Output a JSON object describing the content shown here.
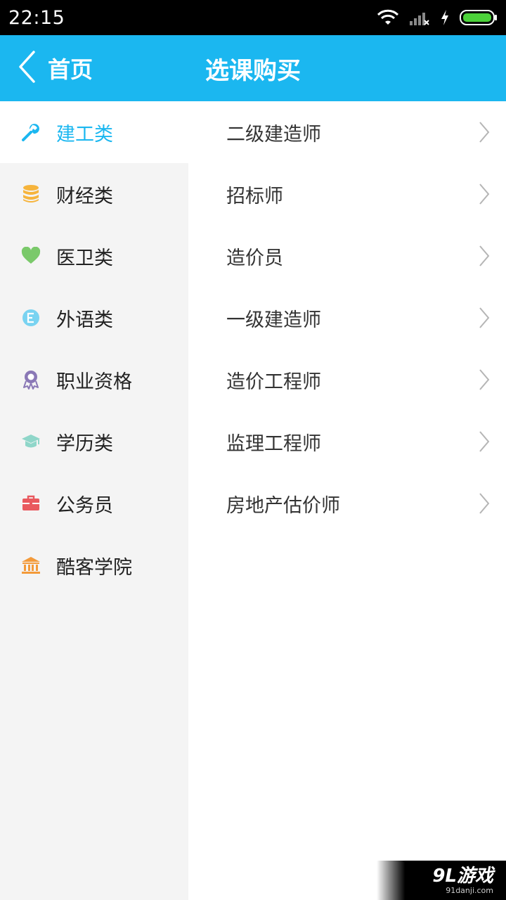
{
  "status_bar": {
    "time": "22:15"
  },
  "app_bar": {
    "back_label": "首页",
    "title": "选课购买"
  },
  "sidebar": {
    "items": [
      {
        "label": "建工类",
        "icon": "wrench-icon",
        "color": "#1bb7f0",
        "active": true
      },
      {
        "label": "财经类",
        "icon": "coin-stack-icon",
        "color": "#f6b43c"
      },
      {
        "label": "医卫类",
        "icon": "heart-icon",
        "color": "#7ac96a"
      },
      {
        "label": "外语类",
        "icon": "letter-e-icon",
        "color": "#79d3f1"
      },
      {
        "label": "职业资格",
        "icon": "medal-icon",
        "color": "#8a78b6"
      },
      {
        "label": "学历类",
        "icon": "graduation-cap-icon",
        "color": "#8fd6c9"
      },
      {
        "label": "公务员",
        "icon": "briefcase-icon",
        "color": "#e9595e"
      },
      {
        "label": "酷客学院",
        "icon": "building-icon",
        "color": "#f39a3a"
      }
    ]
  },
  "courses": [
    "二级建造师",
    "招标师",
    "造价员",
    "一级建造师",
    "造价工程师",
    "监理工程师",
    "房地产估价师"
  ],
  "watermark": {
    "logo": "9L游戏",
    "url": "91danji.com"
  },
  "colors": {
    "accent": "#1bb7f0",
    "sidebar_bg": "#f4f4f4"
  }
}
